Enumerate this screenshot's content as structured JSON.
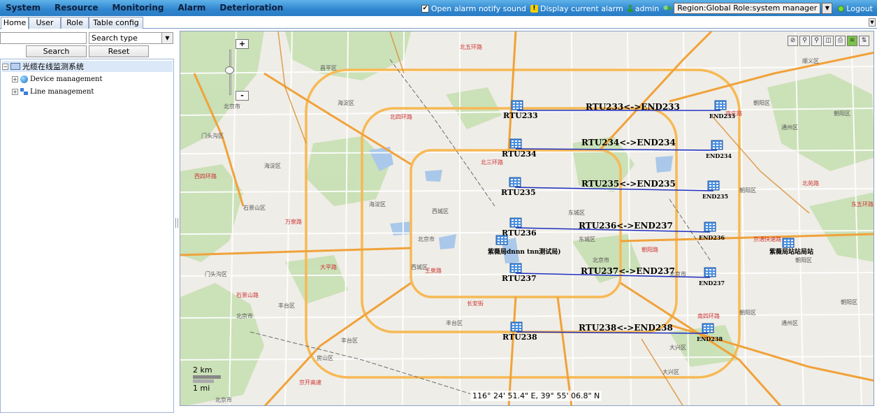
{
  "menu": [
    "System",
    "Resource",
    "Monitoring",
    "Alarm",
    "Deterioration"
  ],
  "topright": {
    "alarm_sound_label": "Open alarm notify sound",
    "alarm_sound_checked": "✔",
    "display_alarm_label": "Display current alarm",
    "user": "admin",
    "region_role": "Region:Global Role:system manager",
    "logout": "Logout"
  },
  "tabs": [
    "Home",
    "User",
    "Role",
    "Table config"
  ],
  "search": {
    "value": "",
    "type_label": "Search type",
    "search_btn": "Search",
    "reset_btn": "Reset"
  },
  "tree": {
    "root": "光缆在线监测系统",
    "children": [
      "Device management",
      "Line management"
    ]
  },
  "map": {
    "zoom_in": "+",
    "zoom_out": "-",
    "scale_km": "2 km",
    "scale_mi": "1 mi",
    "coordinates": "116° 24' 51.4\" E,  39° 55' 06.8\" N",
    "rtus": [
      "RTU233",
      "RTU234",
      "RTU235",
      "RTU236",
      "RTU237",
      "RTU238"
    ],
    "ends": [
      "END233",
      "END234",
      "END235",
      "END236",
      "END237",
      "END238"
    ],
    "links": [
      "RTU233<->END233",
      "RTU234<->END234",
      "RTU235<->END235",
      "RTU236<->END237",
      "RTU237<->END237",
      "RTU238<->END238"
    ],
    "extra_labels": [
      "紫薇局dnnn tnn测试局)",
      "紫薇局站站局站"
    ],
    "link_color": "#1f2fbf",
    "places": [
      "北京市",
      "海淀区",
      "门头沟区",
      "石景山区",
      "西城区",
      "东城区",
      "朝阳区",
      "丰台区",
      "大兴区",
      "通州区",
      "顺义区",
      "昌平区",
      "房山区",
      "门头沟区",
      "北京市",
      "朝阳区",
      "北京市",
      "丰台区",
      "朝阳区",
      "通州区",
      "大兴区",
      "北京市",
      "丰台区",
      "海淀区",
      "北京市",
      "朝阳区",
      "东城区",
      "朝阳区",
      "西城区",
      "北京市",
      "海淀区",
      "朝阳区"
    ],
    "roads": [
      "大平路",
      "王泉路",
      "亦庄路",
      "北五环路",
      "长安街",
      "京通快速路",
      "京开高速",
      "南四环路",
      "北四环路",
      "北三环路",
      "万泉路",
      "北苑路",
      "朝阳路",
      "东五环路",
      "西四环路",
      "石景山路"
    ]
  }
}
